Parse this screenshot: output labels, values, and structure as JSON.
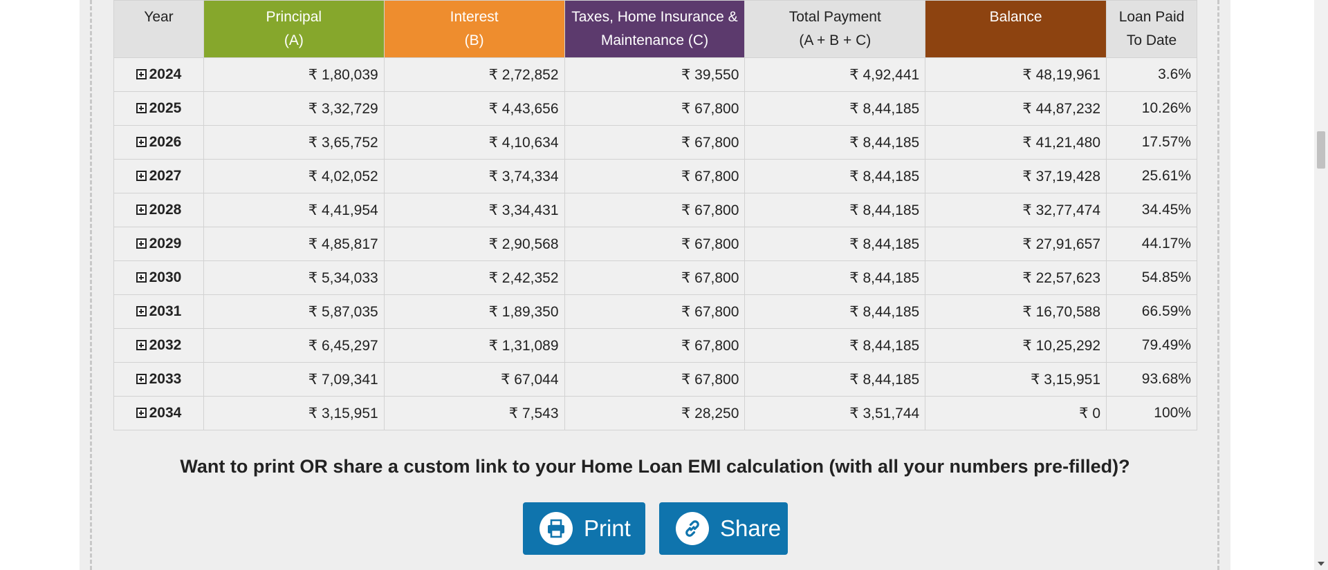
{
  "table": {
    "headers": {
      "year": "Year",
      "principal_line1": "Principal",
      "principal_line2": "(A)",
      "interest_line1": "Interest",
      "interest_line2": "(B)",
      "taxes_line1": "Taxes, Home Insurance &",
      "taxes_line2": "Maintenance (C)",
      "total_line1": "Total Payment",
      "total_line2": "(A + B + C)",
      "balance": "Balance",
      "paid_line1": "Loan Paid",
      "paid_line2": "To Date"
    },
    "rows": [
      {
        "year": "2024",
        "principal": "₹ 1,80,039",
        "interest": "₹ 2,72,852",
        "taxes": "₹ 39,550",
        "total": "₹ 4,92,441",
        "balance": "₹ 48,19,961",
        "paid": "3.6%"
      },
      {
        "year": "2025",
        "principal": "₹ 3,32,729",
        "interest": "₹ 4,43,656",
        "taxes": "₹ 67,800",
        "total": "₹ 8,44,185",
        "balance": "₹ 44,87,232",
        "paid": "10.26%"
      },
      {
        "year": "2026",
        "principal": "₹ 3,65,752",
        "interest": "₹ 4,10,634",
        "taxes": "₹ 67,800",
        "total": "₹ 8,44,185",
        "balance": "₹ 41,21,480",
        "paid": "17.57%"
      },
      {
        "year": "2027",
        "principal": "₹ 4,02,052",
        "interest": "₹ 3,74,334",
        "taxes": "₹ 67,800",
        "total": "₹ 8,44,185",
        "balance": "₹ 37,19,428",
        "paid": "25.61%"
      },
      {
        "year": "2028",
        "principal": "₹ 4,41,954",
        "interest": "₹ 3,34,431",
        "taxes": "₹ 67,800",
        "total": "₹ 8,44,185",
        "balance": "₹ 32,77,474",
        "paid": "34.45%"
      },
      {
        "year": "2029",
        "principal": "₹ 4,85,817",
        "interest": "₹ 2,90,568",
        "taxes": "₹ 67,800",
        "total": "₹ 8,44,185",
        "balance": "₹ 27,91,657",
        "paid": "44.17%"
      },
      {
        "year": "2030",
        "principal": "₹ 5,34,033",
        "interest": "₹ 2,42,352",
        "taxes": "₹ 67,800",
        "total": "₹ 8,44,185",
        "balance": "₹ 22,57,623",
        "paid": "54.85%"
      },
      {
        "year": "2031",
        "principal": "₹ 5,87,035",
        "interest": "₹ 1,89,350",
        "taxes": "₹ 67,800",
        "total": "₹ 8,44,185",
        "balance": "₹ 16,70,588",
        "paid": "66.59%"
      },
      {
        "year": "2032",
        "principal": "₹ 6,45,297",
        "interest": "₹ 1,31,089",
        "taxes": "₹ 67,800",
        "total": "₹ 8,44,185",
        "balance": "₹ 10,25,292",
        "paid": "79.49%"
      },
      {
        "year": "2033",
        "principal": "₹ 7,09,341",
        "interest": "₹ 67,044",
        "taxes": "₹ 67,800",
        "total": "₹ 8,44,185",
        "balance": "₹ 3,15,951",
        "paid": "93.68%"
      },
      {
        "year": "2034",
        "principal": "₹ 3,15,951",
        "interest": "₹ 7,543",
        "taxes": "₹ 28,250",
        "total": "₹ 3,51,744",
        "balance": "₹ 0",
        "paid": "100%"
      }
    ]
  },
  "share_section": {
    "prompt": "Want to print OR share a custom link to your Home Loan EMI calculation (with all your numbers pre-filled)?",
    "print_label": "Print",
    "share_label": "Share",
    "print_icon": "printer-icon",
    "share_icon": "link-icon"
  },
  "colors": {
    "principal": "#86a72c",
    "interest": "#ee8d2e",
    "taxes": "#5c3a6d",
    "balance": "#8d4310",
    "button": "#0f74ad"
  }
}
